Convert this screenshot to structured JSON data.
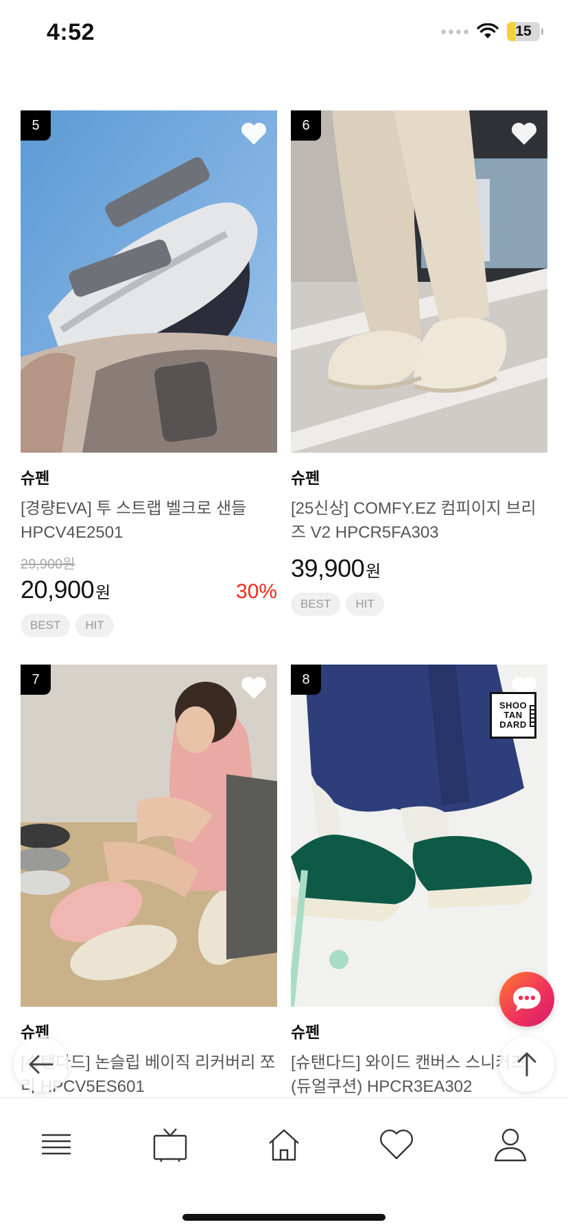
{
  "status_bar": {
    "time": "4:52",
    "battery": "15",
    "battery_level": 0.15
  },
  "products": [
    {
      "rank": "5",
      "brand": "슈펜",
      "name": "[경량EVA] 투 스트랩 벨크로 샌들 HPCV4E2501",
      "original_price": "29,900원",
      "price": "20,900",
      "currency": "원",
      "discount": "30%",
      "tags": [
        "BEST",
        "HIT"
      ],
      "liked": false
    },
    {
      "rank": "6",
      "brand": "슈펜",
      "name": "[25신상] COMFY.EZ 컴피이지 브리즈 V2 HPCR5FA303",
      "price": "39,900",
      "currency": "원",
      "tags": [
        "BEST",
        "HIT"
      ],
      "liked": false
    },
    {
      "rank": "7",
      "brand": "슈펜",
      "name": "[슈탠다드] 논슬립 베이직 리커버리 쪼리 HPCV5ES601",
      "liked": false
    },
    {
      "rank": "8",
      "brand": "슈펜",
      "name": "[슈탠다드] 와이드 캔버스 스니커즈 (듀얼쿠션) HPCR3EA302",
      "logo_text": [
        "SHOO",
        "TAN",
        "DARD"
      ],
      "liked": false
    }
  ],
  "floating": {
    "chat": "chat-bubble-icon",
    "back": "arrow-left-icon",
    "top": "arrow-up-icon"
  },
  "bottom_nav": [
    {
      "icon": "menu-icon"
    },
    {
      "icon": "tv-icon"
    },
    {
      "icon": "home-icon"
    },
    {
      "icon": "heart-icon"
    },
    {
      "icon": "user-icon"
    }
  ],
  "colors": {
    "discount": "#ef2a1a",
    "tag_bg": "#f0f0f0",
    "chat_gradient_start": "#ff7a2d",
    "chat_gradient_end": "#d61a6f"
  }
}
